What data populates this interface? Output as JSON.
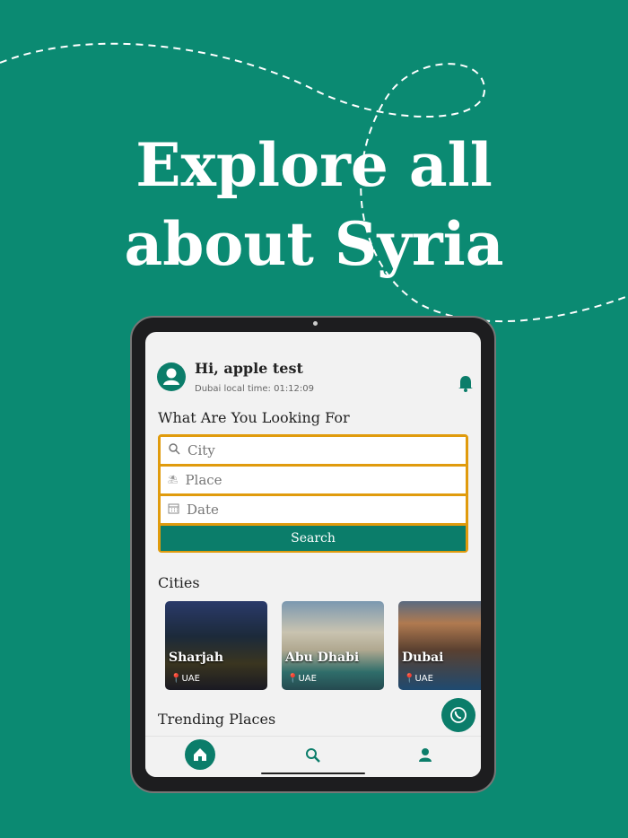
{
  "headline": {
    "line1": "Explore all",
    "line2": "about Syria"
  },
  "app": {
    "greeting": "Hi, apple test",
    "local_time": "Dubai local time: 01:12:09",
    "search_heading": "What Are You Looking For",
    "fields": {
      "city": "City",
      "place": "Place",
      "date": "Date"
    },
    "search_label": "Search",
    "cities_heading": "Cities",
    "cities": [
      {
        "name": "Sharjah",
        "country": "UAE"
      },
      {
        "name": "Abu Dhabi",
        "country": "UAE"
      },
      {
        "name": "Dubai",
        "country": "UAE"
      }
    ],
    "trending_heading": "Trending Places"
  },
  "colors": {
    "background": "#0b8a72",
    "primary": "#0b7d6a",
    "accent": "#e09b0d"
  }
}
